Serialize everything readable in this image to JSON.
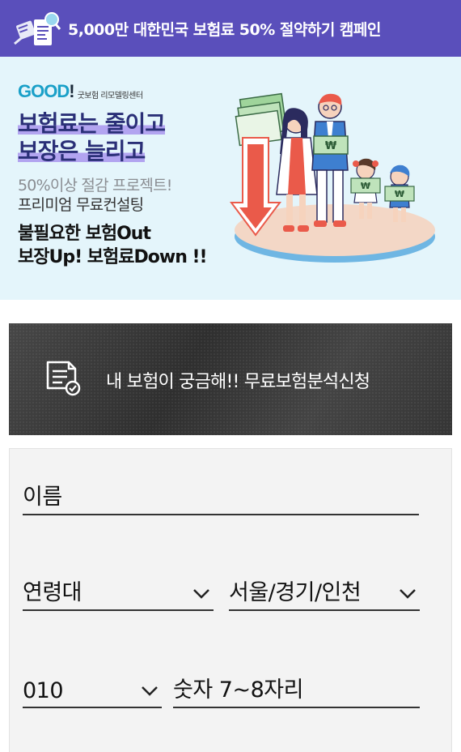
{
  "banner": {
    "title": "5,000만 대한민국 보험료 50% 절약하기 캠페인",
    "icon": "document-search-icon",
    "color": "#5a4fbb"
  },
  "hero": {
    "logo": "GOOD",
    "logo_mark": "!",
    "brand_sub": "굿보험 리모델링센터",
    "headline_1": "보험료는 줄이고",
    "headline_2": "보장은 늘리고",
    "line_3": "50%이상 절감 프로젝트!",
    "line_4": "프리미엄 무료컨설팅",
    "promo_1": "불필요한 보험Out",
    "promo_2": "보장Up! 보험료Down !!",
    "background": "#e4f5fb"
  },
  "apply": {
    "label": "내 보험이 궁금해!!  무료보험분석신청",
    "icon": "checklist-icon"
  },
  "form": {
    "name_placeholder": "이름",
    "age_select": "연령대",
    "region_select": "서울/경기/인천",
    "phone_prefix": "010",
    "phone_placeholder": "숫자 7~8자리"
  }
}
